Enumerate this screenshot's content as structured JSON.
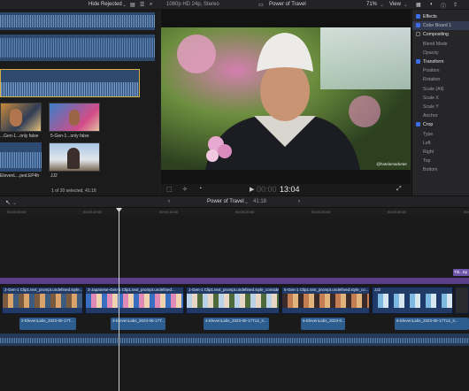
{
  "topbar": {
    "filter": "Hide Rejected",
    "format": "1080p HD 24p, Stereo",
    "project": "Power of Travel",
    "zoom": "71%",
    "view": "View"
  },
  "browser": {
    "clips": [
      {
        "label": "...Gen-1...only false"
      },
      {
        "label": "5-Gen-1...only false"
      },
      {
        "label": "ElevenL...ped.EP4h"
      },
      {
        "label": "JJ2"
      }
    ],
    "selection": "1 of 20 selected, 41:18"
  },
  "viewer": {
    "timecode": "13:04",
    "timecode_dim": "00:00",
    "watermark": "@hotelemarketer"
  },
  "inspector": {
    "rows": [
      {
        "label": "Effects",
        "type": "section",
        "checked": true
      },
      {
        "label": "Color Board 1",
        "type": "item",
        "checked": true,
        "highlight": true
      },
      {
        "label": "Compositing",
        "type": "section",
        "checked": false
      },
      {
        "label": "Blend Mode",
        "type": "param"
      },
      {
        "label": "Opacity",
        "type": "param"
      },
      {
        "label": "Transform",
        "type": "section",
        "checked": true
      },
      {
        "label": "Position",
        "type": "param"
      },
      {
        "label": "Rotation",
        "type": "param"
      },
      {
        "label": "Scale (All)",
        "type": "param"
      },
      {
        "label": "Scale X",
        "type": "param"
      },
      {
        "label": "Scale Y",
        "type": "param"
      },
      {
        "label": "Anchor",
        "type": "param"
      },
      {
        "label": "Crop",
        "type": "section",
        "checked": true
      },
      {
        "label": "Type",
        "type": "param"
      },
      {
        "label": "Left",
        "type": "param"
      },
      {
        "label": "Right",
        "type": "param"
      },
      {
        "label": "Top",
        "type": "param"
      },
      {
        "label": "Bottom",
        "type": "param"
      }
    ]
  },
  "timeline": {
    "project": "Power of Travel",
    "duration": "41:18",
    "ruler": [
      "00:00:00:00",
      "00:00:10:00",
      "00:00:15:00",
      "00:00:20:00",
      "00:00:25:00",
      "00:00:30:00",
      "00:00:35:00"
    ],
    "title_clip": "Titl...Sp",
    "video_clips": [
      {
        "label": "2-Gen-1 Clip1.text_prompt.undefined.style..."
      },
      {
        "label": "3-Japanese-Gen-1 Clip1.text_prompt.undefined..."
      },
      {
        "label": "1-Gen-1 Clip1.text_prompt.undefined.style_conside..."
      },
      {
        "label": "5-Gen-1 Clip1.text_prompt.undefined.style_co..."
      },
      {
        "label": "JJ2"
      }
    ],
    "audio_clips": [
      {
        "label": "2-ElevenLabs_2023-06-17T..."
      },
      {
        "label": "3-ElevenLabs_2023-06-17T..."
      },
      {
        "label": "4-ElevenLabs_2023-06-17T14_3..."
      },
      {
        "label": "5-ElevenLabs_2023-0..."
      },
      {
        "label": "6-ElevenLabs_2023-06-17T14_3..."
      }
    ]
  },
  "colors": {
    "accent": "#3d6ee8",
    "video_clip": "#213a66",
    "audio_clip": "#2d5d8f",
    "title_bar": "#5b3f8a"
  }
}
